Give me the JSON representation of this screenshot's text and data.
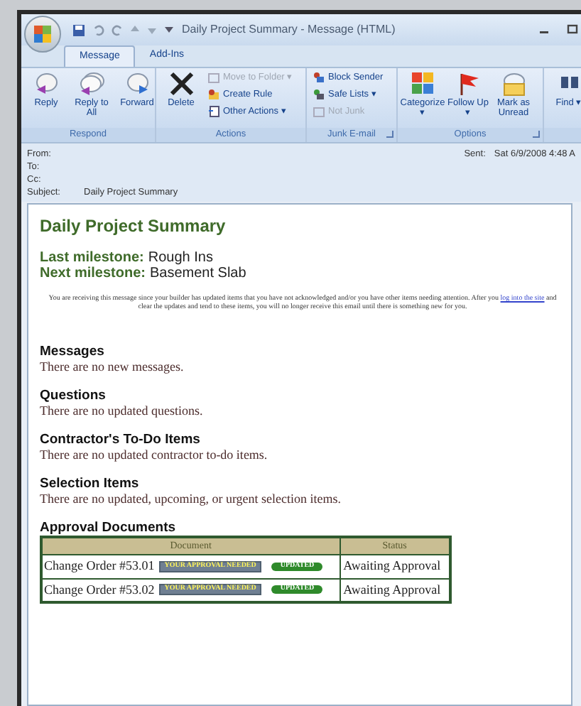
{
  "window": {
    "title": "Daily Project Summary - Message (HTML)"
  },
  "tabs": [
    {
      "label": "Message",
      "selected": true
    },
    {
      "label": "Add-Ins",
      "selected": false
    }
  ],
  "ribbon": [
    {
      "label": "Respond",
      "items": [
        {
          "kind": "large",
          "label": "Reply",
          "disabled": false
        },
        {
          "kind": "large",
          "label": "Reply to All",
          "disabled": false
        },
        {
          "kind": "large",
          "label": "Forward",
          "disabled": false
        }
      ]
    },
    {
      "label": "Actions",
      "items": [
        {
          "kind": "large",
          "label": "Delete",
          "disabled": false
        },
        {
          "kind": "small",
          "label": "Move to Folder ▾",
          "disabled": true
        },
        {
          "kind": "small",
          "label": "Create Rule",
          "disabled": false
        },
        {
          "kind": "small",
          "label": "Other Actions ▾",
          "disabled": false
        }
      ]
    },
    {
      "label": "Junk E-mail",
      "launcher": true,
      "items": [
        {
          "kind": "small",
          "label": "Block Sender",
          "disabled": false
        },
        {
          "kind": "small",
          "label": "Safe Lists ▾",
          "disabled": false
        },
        {
          "kind": "small",
          "label": "Not Junk",
          "disabled": true
        }
      ]
    },
    {
      "label": "Options",
      "launcher": true,
      "items": [
        {
          "kind": "large",
          "label": "Categorize ▾",
          "disabled": false
        },
        {
          "kind": "large",
          "label": "Follow Up ▾",
          "disabled": false
        },
        {
          "kind": "large",
          "label": "Mark as Unread",
          "disabled": false
        }
      ]
    },
    {
      "items": [
        {
          "kind": "large",
          "label": "Find ▾",
          "disabled": false
        }
      ]
    }
  ],
  "header": {
    "fields": [
      {
        "label": "From:"
      },
      {
        "label": "To:"
      },
      {
        "label": "Cc:"
      },
      {
        "label": "Subject:",
        "value": "Daily Project Summary"
      }
    ],
    "sent_label": "Sent:",
    "sent_value": "Sat 6/9/2008 4:48 A"
  },
  "email": {
    "title": "Daily Project Summary",
    "milestones": [
      {
        "label": "Last milestone:",
        "value": "Rough Ins"
      },
      {
        "label": "Next milestone:",
        "value": "Basement Slab"
      }
    ],
    "notice_before": "You are receiving this message since your builder has updated items that you have not acknowledged and/or you have other items needing attention. After you",
    "notice_link": "log into the site",
    "notice_after": "and clear the updates and tend to these items, you will no longer receive this email until there is something new for you.",
    "sections": [
      {
        "heading": "Messages",
        "text": "There are no new messages."
      },
      {
        "heading": "Questions",
        "text": "There are no updated questions."
      },
      {
        "heading": "Contractor's To-Do Items",
        "text": "There are no updated contractor to-do items."
      },
      {
        "heading": "Selection Items",
        "text": "There are no updated, upcoming, or urgent selection items."
      }
    ],
    "approvals": {
      "heading": "Approval Documents",
      "columns": [
        "Document",
        "Status"
      ],
      "rows": [
        {
          "document": "Change Order #53.01",
          "badge": "YOUR APPROVAL NEEDED",
          "tag": "UPDATED",
          "status": "Awaiting Approval"
        },
        {
          "document": "Change Order #53.02",
          "badge": "YOUR APPROVAL NEEDED",
          "tag": "UPDATED",
          "status": "Awaiting Approval"
        }
      ]
    }
  }
}
